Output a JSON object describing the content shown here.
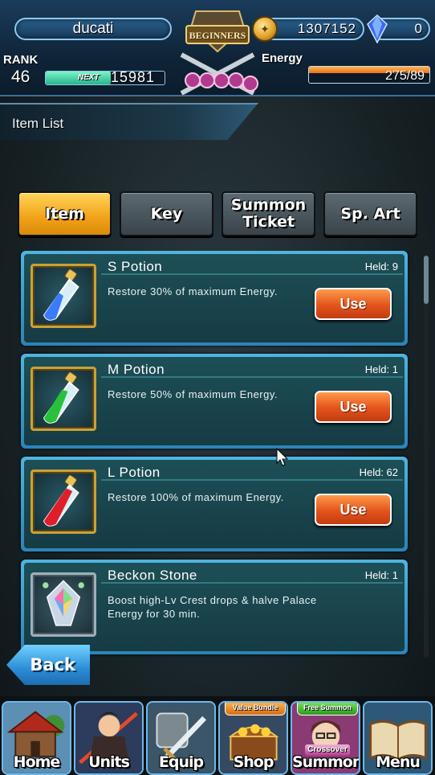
{
  "player": {
    "name": "ducati",
    "rank_label": "RANK",
    "rank": "46",
    "next_label": "NEXT",
    "next_exp": "15981",
    "exp_fill": 0.55
  },
  "currency": {
    "gold": "1307152",
    "gems": "0"
  },
  "emblem": {
    "text": "BEGINNERS"
  },
  "energy": {
    "label": "Energy",
    "value": "275/89",
    "fill": 1.0
  },
  "screen": {
    "title": "Item List"
  },
  "tabs": [
    {
      "label": "Item",
      "active": true
    },
    {
      "label": "Key",
      "active": false
    },
    {
      "label": "Summon Ticket",
      "active": false
    },
    {
      "label": "Sp. Art",
      "active": false
    }
  ],
  "items": [
    {
      "name": "S Potion",
      "held": "Held: 9",
      "desc": "Restore 30% of maximum Energy.",
      "button": "Use",
      "potion_color": "#3b7bff"
    },
    {
      "name": "M Potion",
      "held": "Held: 1",
      "desc": "Restore 50% of maximum Energy.",
      "button": "Use",
      "potion_color": "#27c23a"
    },
    {
      "name": "L Potion",
      "held": "Held: 62",
      "desc": "Restore 100% of maximum Energy.",
      "button": "Use",
      "potion_color": "#e01e2a"
    },
    {
      "name": "Beckon Stone",
      "held": "Held: 1",
      "desc": "Boost high-Lv Crest drops & halve Palace Energy for 30 min.",
      "button": ""
    }
  ],
  "back_label": "Back",
  "nav": [
    {
      "label": "Home",
      "icon": "house-icon"
    },
    {
      "label": "Units",
      "icon": "hero-icon"
    },
    {
      "label": "Equip",
      "icon": "sword-icon"
    },
    {
      "label": "Shop",
      "icon": "treasure-chest-icon",
      "ribbon": "Value Bundle"
    },
    {
      "label": "Summon",
      "icon": "summon-character-icon",
      "ribbon": "Free Summon",
      "sub": "Crossover"
    },
    {
      "label": "Menu",
      "icon": "book-icon"
    }
  ],
  "colors": {
    "accent_blue": "#4fb5e0",
    "tab_active": "#f1a217",
    "use_button": "#e3531c",
    "energy_bar": "#e6711a"
  }
}
